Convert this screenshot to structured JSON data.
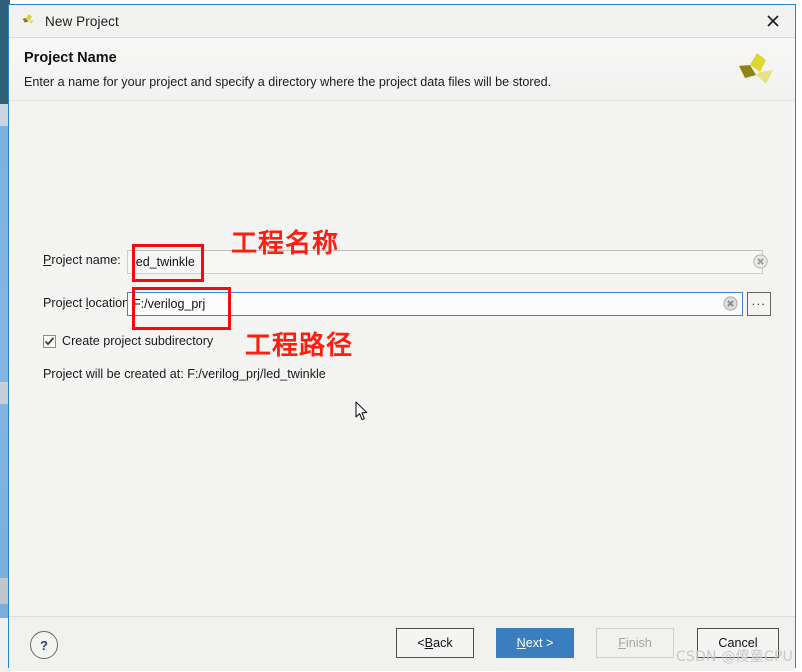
{
  "window": {
    "title": "New Project",
    "icon": "vivado-logo-icon",
    "close_label": "×"
  },
  "header": {
    "title": "Project Name",
    "description": "Enter a name for your project and specify a directory where the project data files will be stored.",
    "brand_icon": "xilinx-vivado-logo-icon"
  },
  "form": {
    "name_label_pre": "P",
    "name_label_accel": "r",
    "name_label_post": "oject name:",
    "name_label": "Project name:",
    "name_value": "led_twinkle",
    "location_label": "Project location",
    "location_label_pre": "Project ",
    "location_label_accel": "l",
    "location_label_post": "ocation",
    "location_value": "F:/verilog_prj",
    "browse_label": "...",
    "checkbox_label": "Create project subdirectory",
    "checkbox_checked": true,
    "created_at_text": "Project will be created at: F:/verilog_prj/led_twinkle",
    "clear_icon": "clear-circle-x-icon"
  },
  "annotations": {
    "project_name_note": "工程名称",
    "project_path_note": "工程路径",
    "highlight_color": "#f20d0d",
    "text_color": "#fd1e10"
  },
  "footer": {
    "help_label": "?",
    "back_pre": "< ",
    "back_accel": "B",
    "back_post": "ack",
    "back_label": "< Back",
    "next_accel": "N",
    "next_post": "ext >",
    "next_label": "Next >",
    "finish_accel": "F",
    "finish_post": "inish",
    "finish_label": "Finish",
    "finish_enabled": false,
    "cancel_label": "Cancel",
    "accent_color": "#3a7ebf"
  },
  "watermark": {
    "text": "CSDN @傻童CPU"
  }
}
